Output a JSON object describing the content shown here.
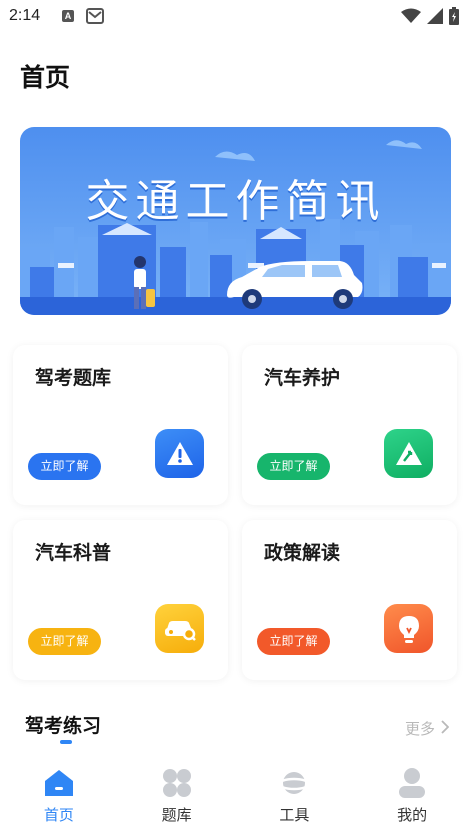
{
  "status_bar": {
    "time": "2:14",
    "icons": [
      "a-notification-icon",
      "mail-icon",
      "wifi-icon",
      "signal-icon",
      "battery-icon"
    ]
  },
  "page": {
    "title": "首页"
  },
  "banner": {
    "text": "交通工作简讯",
    "colors": {
      "sky": "#5a98f0",
      "text": "#ffffff",
      "road": "#2c64d9"
    }
  },
  "cards": [
    {
      "title": "驾考题库",
      "button": "立即了解",
      "button_color": "#2a74f0",
      "icon": "warning-triangle-icon",
      "icon_colors": [
        "#3d8ef7",
        "#1e63e8"
      ]
    },
    {
      "title": "汽车养护",
      "button": "立即了解",
      "button_color": "#17b56c",
      "icon": "road-sign-icon",
      "icon_colors": [
        "#2ed38a",
        "#0fae62"
      ]
    },
    {
      "title": "汽车科普",
      "button": "立即了解",
      "button_color": "#f7b311",
      "icon": "car-search-icon",
      "icon_colors": [
        "#ffd23c",
        "#f6ad0a"
      ]
    },
    {
      "title": "政策解读",
      "button": "立即了解",
      "button_color": "#f2592a",
      "icon": "lightbulb-icon",
      "icon_colors": [
        "#ff8c4c",
        "#f0552a"
      ]
    }
  ],
  "section": {
    "title": "驾考练习",
    "more": "更多"
  },
  "bottom_nav": [
    {
      "label": "首页",
      "icon": "home-icon",
      "active": true
    },
    {
      "label": "题库",
      "icon": "grid-icon",
      "active": false
    },
    {
      "label": "工具",
      "icon": "planet-icon",
      "active": false
    },
    {
      "label": "我的",
      "icon": "user-icon",
      "active": false
    }
  ],
  "colors": {
    "accent": "#2f86f5",
    "inactive_icon": "#c9ccd1"
  }
}
